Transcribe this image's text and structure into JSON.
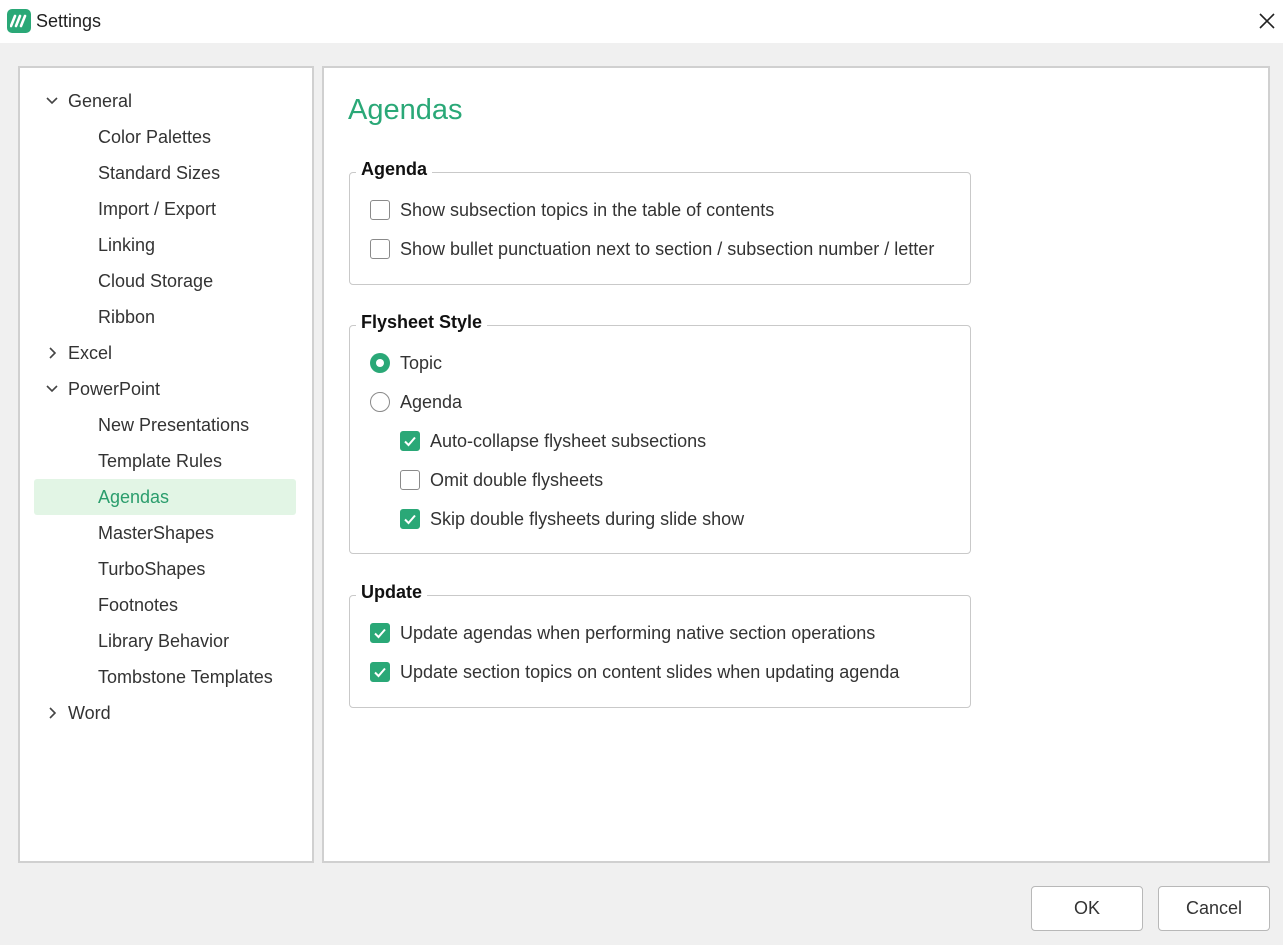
{
  "window": {
    "title": "Settings",
    "app_icon": "app-logo-icon",
    "close_icon": "close-icon"
  },
  "accent_color": "#2aa877",
  "nav": {
    "items": [
      {
        "label": "General",
        "type": "parent",
        "expanded": true
      },
      {
        "label": "Color Palettes",
        "type": "child"
      },
      {
        "label": "Standard Sizes",
        "type": "child"
      },
      {
        "label": "Import / Export",
        "type": "child"
      },
      {
        "label": "Linking",
        "type": "child"
      },
      {
        "label": "Cloud Storage",
        "type": "child"
      },
      {
        "label": "Ribbon",
        "type": "child"
      },
      {
        "label": "Excel",
        "type": "parent",
        "expanded": false
      },
      {
        "label": "PowerPoint",
        "type": "parent",
        "expanded": true
      },
      {
        "label": "New Presentations",
        "type": "child"
      },
      {
        "label": "Template Rules",
        "type": "child"
      },
      {
        "label": "Agendas",
        "type": "child",
        "selected": true
      },
      {
        "label": "MasterShapes",
        "type": "child"
      },
      {
        "label": "TurboShapes",
        "type": "child"
      },
      {
        "label": "Footnotes",
        "type": "child"
      },
      {
        "label": "Library Behavior",
        "type": "child"
      },
      {
        "label": "Tombstone Templates",
        "type": "child"
      },
      {
        "label": "Word",
        "type": "parent",
        "expanded": false
      }
    ]
  },
  "page": {
    "title": "Agendas",
    "agenda_group": {
      "label": "Agenda",
      "options": [
        {
          "label": "Show subsection topics in the table of contents",
          "checked": false
        },
        {
          "label": "Show bullet punctuation next to section / subsection number / letter",
          "checked": false
        }
      ]
    },
    "flysheet_group": {
      "label": "Flysheet Style",
      "radios": [
        {
          "label": "Topic",
          "checked": true
        },
        {
          "label": "Agenda",
          "checked": false
        }
      ],
      "sub_options": [
        {
          "label": "Auto-collapse flysheet subsections",
          "checked": true
        },
        {
          "label": "Omit double flysheets",
          "checked": false
        },
        {
          "label": "Skip double flysheets during slide show",
          "checked": true
        }
      ]
    },
    "update_group": {
      "label": "Update",
      "options": [
        {
          "label": "Update agendas when performing native section operations",
          "checked": true
        },
        {
          "label": "Update section topics on content slides when updating agenda",
          "checked": true
        }
      ]
    }
  },
  "buttons": {
    "ok": "OK",
    "cancel": "Cancel"
  }
}
